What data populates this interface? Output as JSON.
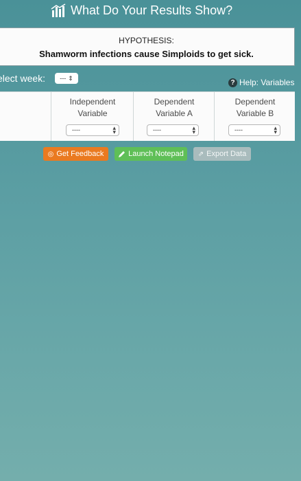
{
  "header": {
    "title": "What Do Your Results Show?",
    "icon": "bar-chart-icon"
  },
  "hypothesis": {
    "heading": "HYPOTHESIS:",
    "text": "Shamworm infections cause Simploids to get sick."
  },
  "week": {
    "label": "elect week:",
    "value": "---"
  },
  "help": {
    "icon": "question-circle-icon",
    "label": "Help: Variables"
  },
  "variables": {
    "columns": [
      {
        "line1": "Independent",
        "line2": "Variable",
        "value": "----"
      },
      {
        "line1": "Dependent",
        "line2": "Variable A",
        "value": "----"
      },
      {
        "line1": "Dependent",
        "line2": "Variable B",
        "value": "----"
      }
    ]
  },
  "buttons": {
    "feedback": "Get Feedback",
    "notepad": "Launch Notepad",
    "export": "Export Data"
  },
  "colors": {
    "background": "#5b9ea3",
    "feedback": "#ea7a20",
    "notepad": "#5fbf57",
    "export": "#a9bcbd"
  }
}
